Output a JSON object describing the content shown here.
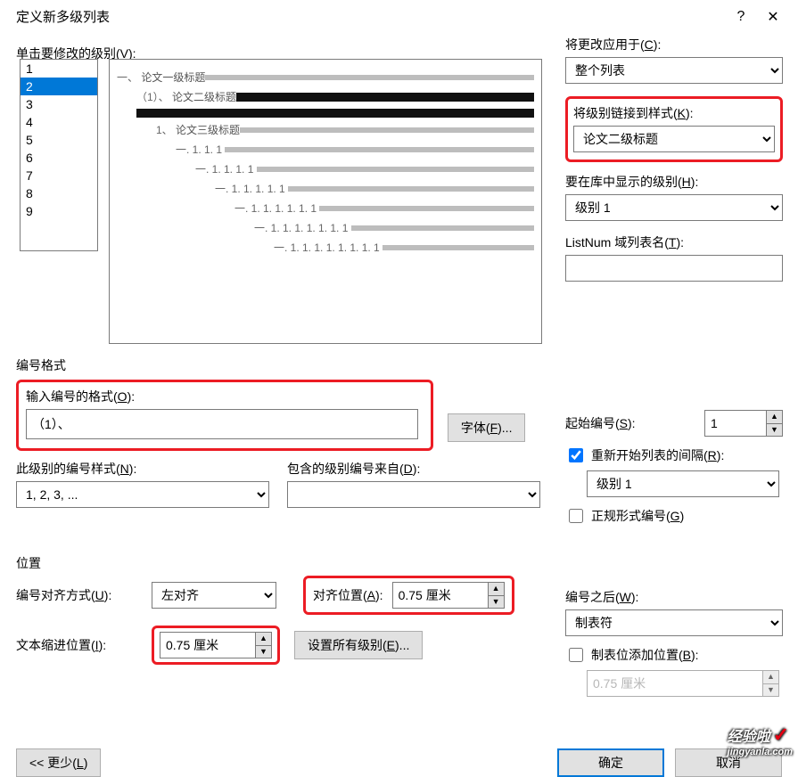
{
  "titlebar": {
    "title": "定义新多级列表",
    "help": "?",
    "close": "✕"
  },
  "left": {
    "levels_label": "单击要修改的级别(",
    "levels_key": "V",
    "levels_label2": "):",
    "levels": [
      "1",
      "2",
      "3",
      "4",
      "5",
      "6",
      "7",
      "8",
      "9"
    ],
    "selected_level": "2"
  },
  "preview": {
    "rows": [
      {
        "indent": 0,
        "text": "一、",
        "label": "论文一级标题",
        "thick": false
      },
      {
        "indent": 1,
        "text": "（1）、",
        "label": "论文二级标题",
        "thick": true
      },
      {
        "indent": 1,
        "text": "",
        "label": "",
        "thick": true,
        "baronly": true
      },
      {
        "indent": 2,
        "text": "1、",
        "label": "论文三级标题",
        "thick": false
      },
      {
        "indent": 3,
        "text": "一. 1. 1. 1",
        "label": "",
        "thick": false
      },
      {
        "indent": 4,
        "text": "一. 1. 1. 1. 1",
        "label": "",
        "thick": false
      },
      {
        "indent": 5,
        "text": "一. 1. 1. 1. 1. 1",
        "label": "",
        "thick": false
      },
      {
        "indent": 6,
        "text": "一. 1. 1. 1. 1. 1. 1",
        "label": "",
        "thick": false
      },
      {
        "indent": 7,
        "text": "一. 1. 1. 1. 1. 1. 1. 1",
        "label": "",
        "thick": false
      },
      {
        "indent": 8,
        "text": "一. 1. 1. 1. 1. 1. 1. 1. 1",
        "label": "",
        "thick": false
      }
    ]
  },
  "right": {
    "apply_label": "将更改应用于(",
    "apply_key": "C",
    "apply_label2": "):",
    "apply_value": "整个列表",
    "link_style_label": "将级别链接到样式(",
    "link_style_key": "K",
    "link_style_label2": "):",
    "link_style_value": "论文二级标题",
    "gallery_label": "要在库中显示的级别(",
    "gallery_key": "H",
    "gallery_label2": "):",
    "gallery_value": "级别 1",
    "listnum_label": "ListNum 域列表名(",
    "listnum_key": "T",
    "listnum_label2": "):",
    "listnum_value": ""
  },
  "numfmt": {
    "section_title": "编号格式",
    "enter_label": "输入编号的格式(",
    "enter_key": "O",
    "enter_label2": "):",
    "enter_value": "（1）、",
    "font_btn": "字体(",
    "font_key": "F",
    "font_btn2": ")...",
    "style_label": "此级别的编号样式(",
    "style_key": "N",
    "style_label2": "):",
    "style_value": "1, 2, 3, ...",
    "include_label": "包含的级别编号来自(",
    "include_key": "D",
    "include_label2": "):",
    "include_value": ""
  },
  "right2": {
    "start_label": "起始编号(",
    "start_key": "S",
    "start_label2": "):",
    "start_value": "1",
    "restart_chk": true,
    "restart_label": "重新开始列表的间隔(",
    "restart_key": "R",
    "restart_label2": "):",
    "restart_value": "级别 1",
    "legal_chk": false,
    "legal_label": "正规形式编号(",
    "legal_key": "G",
    "legal_label2": ")"
  },
  "position": {
    "section_title": "位置",
    "align_label": "编号对齐方式(",
    "align_key": "U",
    "align_label2": "):",
    "align_value": "左对齐",
    "alignpos_label": "对齐位置(",
    "alignpos_key": "A",
    "alignpos_label2": "):",
    "alignpos_value": "0.75 厘米",
    "indent_label": "文本缩进位置(",
    "indent_key": "I",
    "indent_label2": "):",
    "indent_value": "0.75 厘米",
    "setall_btn": "设置所有级别(",
    "setall_key": "E",
    "setall_btn2": ")..."
  },
  "right3": {
    "follow_label": "编号之后(",
    "follow_key": "W",
    "follow_label2": "):",
    "follow_value": "制表符",
    "tab_chk": false,
    "tab_label": "制表位添加位置(",
    "tab_key": "B",
    "tab_label2": "):",
    "tab_value": "0.75 厘米"
  },
  "bottom": {
    "less": "<<  更少(",
    "less_key": "L",
    "less2": ")",
    "ok": "确定",
    "cancel": "取消"
  },
  "watermark": {
    "line1": "经验啦",
    "line2": "jingyanla.com"
  }
}
